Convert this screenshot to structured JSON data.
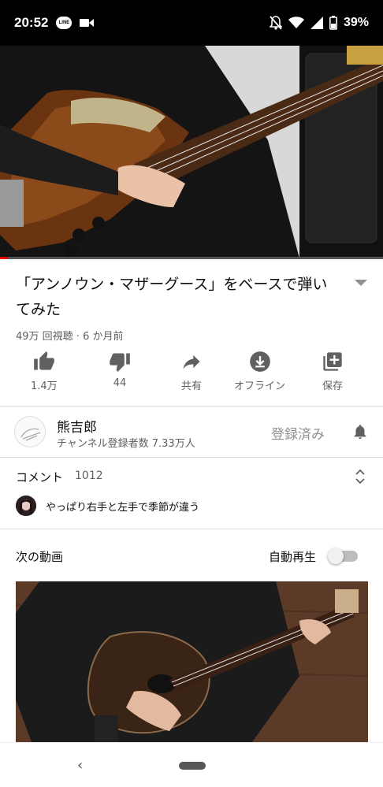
{
  "status_bar": {
    "time": "20:52",
    "line_badge": "LINE",
    "battery": "39%",
    "icons": [
      "line-icon",
      "video-camera-icon",
      "notifications-off-icon",
      "wifi-icon",
      "signal-icon",
      "battery-icon"
    ]
  },
  "video": {
    "progress": 0.02,
    "title": "「アンノウン・マザーグース」をベースで弾いてみた",
    "meta": "49万 回視聴 · 6 か月前"
  },
  "actions": [
    {
      "name": "like",
      "label": "1.4万",
      "icon": "thumb-up-icon"
    },
    {
      "name": "dislike",
      "label": "44",
      "icon": "thumb-down-icon"
    },
    {
      "name": "share",
      "label": "共有",
      "icon": "share-icon"
    },
    {
      "name": "offline",
      "label": "オフライン",
      "icon": "download-icon"
    },
    {
      "name": "save",
      "label": "保存",
      "icon": "playlist-add-icon"
    }
  ],
  "channel": {
    "name": "熊吉郎",
    "subscribers": "チャンネル登録者数 7.33万人",
    "subscribe_state": "登録済み"
  },
  "comments": {
    "title": "コメント",
    "count": "1012",
    "top_comment": "やっぱり右手と左手で季節が違う"
  },
  "up_next": {
    "title": "次の動画",
    "autoplay_label": "自動再生",
    "autoplay_on": false
  },
  "colors": {
    "progress_red": "#ee0000",
    "icon_gray": "#606060"
  }
}
